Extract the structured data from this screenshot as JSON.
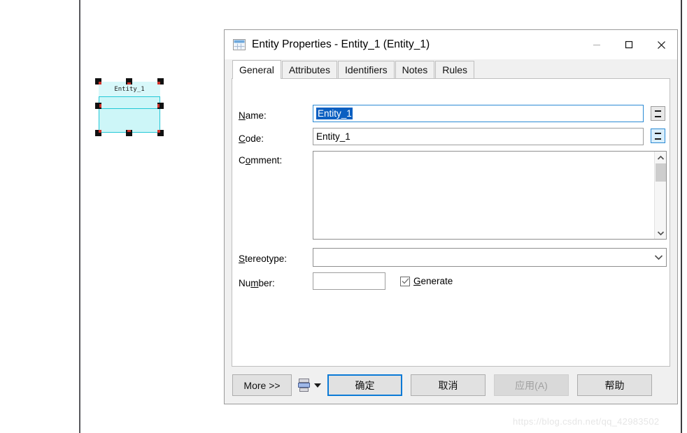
{
  "canvas": {
    "entity": {
      "label": "Entity_1",
      "fill_color": "#cdf6f8",
      "border_color": "#22c8d6",
      "handle_color": "#111111",
      "handle_nub_color": "#d1322a"
    }
  },
  "dialog": {
    "title": "Entity Properties - Entity_1 (Entity_1)",
    "icon": "table-icon",
    "window_controls": {
      "minimize": "minimize-icon",
      "maximize": "maximize-icon",
      "close": "close-icon"
    },
    "tabs": [
      {
        "label": "General",
        "selected": true
      },
      {
        "label": "Attributes",
        "selected": false
      },
      {
        "label": "Identifiers",
        "selected": false
      },
      {
        "label": "Notes",
        "selected": false
      },
      {
        "label": "Rules",
        "selected": false
      }
    ],
    "general": {
      "name": {
        "label_prefix": "",
        "label_accel": "N",
        "label_rest": "ame:",
        "value": "Entity_1",
        "selected": true,
        "focused": true,
        "equals_button": "="
      },
      "code": {
        "label_accel": "C",
        "label_rest": "ode:",
        "value": "Entity_1",
        "equals_button": "="
      },
      "comment": {
        "label_prefix": "C",
        "label_accel": "o",
        "label_rest": "mment:",
        "value": "",
        "scrollbar": "vertical"
      },
      "stereotype": {
        "label_accel": "S",
        "label_rest": "tereotype:",
        "value": "",
        "placeholder": ""
      },
      "number": {
        "label_prefix": "Nu",
        "label_accel": "m",
        "label_rest": "ber:",
        "value": ""
      },
      "generate": {
        "label_accel": "G",
        "label_rest": "enerate",
        "checked": true
      }
    },
    "buttons": {
      "more": "More >>",
      "print": "report-print-icon",
      "print_dropdown": "chevron-down-icon",
      "ok": "确定",
      "cancel": "取消",
      "apply": "应用(A)",
      "apply_disabled": true,
      "help": "帮助"
    },
    "accent_color": "#0b7ad6"
  },
  "watermark": {
    "text": "https://blog.csdn.net/qq_42983502"
  }
}
